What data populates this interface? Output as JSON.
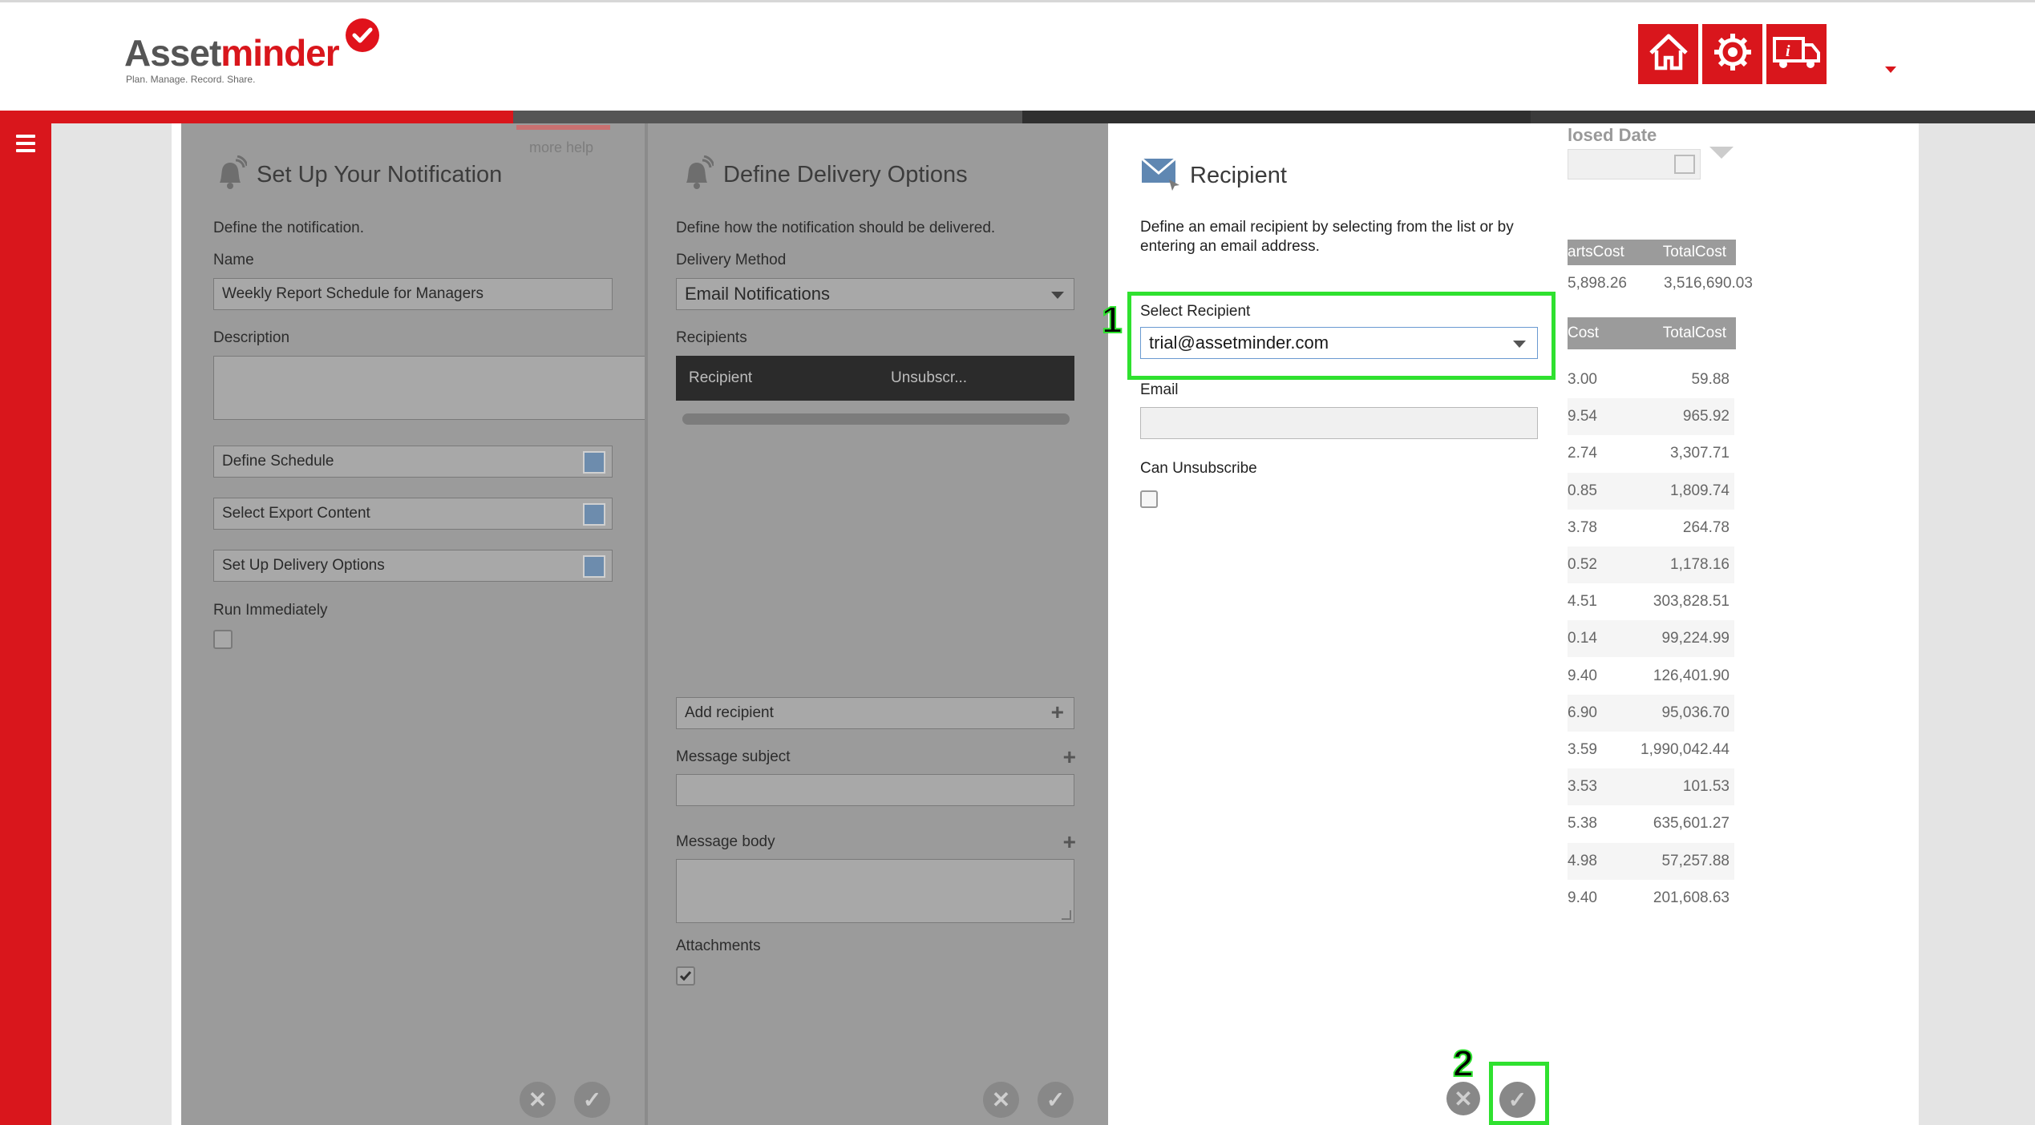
{
  "header": {
    "logo_part1": "Asset",
    "logo_part2": "minder",
    "logo_tagline": "Plan. Manage. Record. Share.",
    "buttons": [
      {
        "icon": "home-icon"
      },
      {
        "icon": "settings-gear-icon"
      },
      {
        "icon": "truck-info-icon"
      }
    ]
  },
  "panel1": {
    "more_help": "more help",
    "title": "Set Up Your Notification",
    "intro": "Define the notification.",
    "name_label": "Name",
    "name_value": "Weekly Report Schedule for Managers",
    "description_label": "Description",
    "define_schedule": "Define Schedule",
    "select_export": "Select Export Content",
    "delivery_options": "Set Up Delivery Options",
    "run_immediately_label": "Run Immediately"
  },
  "panel2": {
    "title": "Define Delivery Options",
    "intro": "Define how the notification should be delivered.",
    "delivery_method_label": "Delivery Method",
    "delivery_method_value": "Email Notifications",
    "recipients_label": "Recipients",
    "recipients_columns": [
      "Recipient",
      "Unsubscr..."
    ],
    "add_recipient": "Add recipient",
    "message_subject_label": "Message subject",
    "message_body_label": "Message body",
    "attachments_label": "Attachments"
  },
  "panel3": {
    "title": "Recipient",
    "intro": "Define an email recipient by selecting from the list or by entering an email address.",
    "select_recipient_label": "Select Recipient",
    "select_recipient_value": "trial@assetminder.com",
    "email_label": "Email",
    "can_unsubscribe_label": "Can Unsubscribe"
  },
  "annotations": {
    "step1": "1",
    "step2": "2"
  },
  "background_table": {
    "closed_date_label": "losed Date",
    "head1": [
      "artsCost",
      "TotalCost"
    ],
    "row1": [
      "5,898.26",
      "3,516,690.03"
    ],
    "head2": [
      "Cost",
      "TotalCost"
    ],
    "rows": [
      [
        "3.00",
        "59.88"
      ],
      [
        "9.54",
        "965.92"
      ],
      [
        "2.74",
        "3,307.71"
      ],
      [
        "0.85",
        "1,809.74"
      ],
      [
        "3.78",
        "264.78"
      ],
      [
        "0.52",
        "1,178.16"
      ],
      [
        "4.51",
        "303,828.51"
      ],
      [
        "0.14",
        "99,224.99"
      ],
      [
        "9.40",
        "126,401.90"
      ],
      [
        "6.90",
        "95,036.70"
      ],
      [
        "3.59",
        "1,990,042.44"
      ],
      [
        "3.53",
        "101.53"
      ],
      [
        "5.38",
        "635,601.27"
      ],
      [
        "4.98",
        "57,257.88"
      ],
      [
        "9.40",
        "201,608.63"
      ]
    ]
  }
}
